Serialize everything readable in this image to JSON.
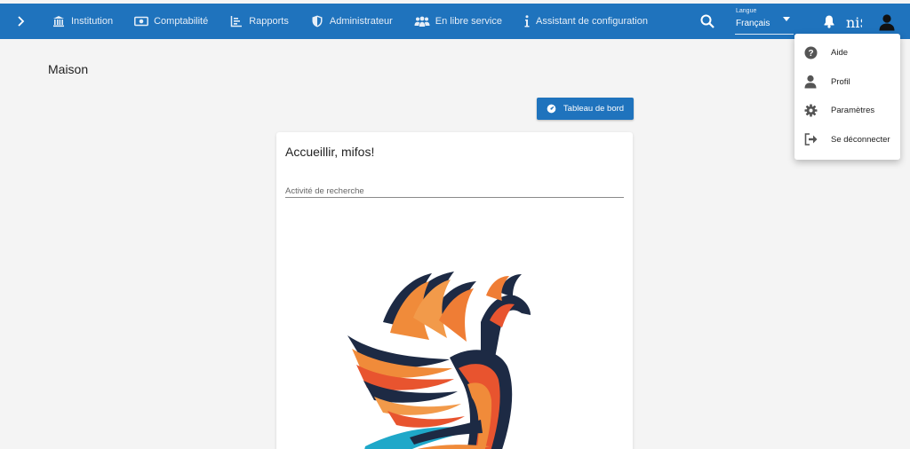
{
  "nav": {
    "items": [
      {
        "label": "Institution",
        "icon": "institution-icon"
      },
      {
        "label": "Comptabilité",
        "icon": "money-icon"
      },
      {
        "label": "Rapports",
        "icon": "chart-icon"
      },
      {
        "label": "Administrateur",
        "icon": "shield-icon"
      },
      {
        "label": "En libre service",
        "icon": "users-icon"
      },
      {
        "label": "Assistant de configuration",
        "icon": "info-icon"
      }
    ],
    "language_label": "Langue",
    "language_value": "Français",
    "brand_text": "ni$"
  },
  "page": {
    "title": "Maison",
    "dashboard_button": "Tableau de bord"
  },
  "card": {
    "welcome": "Accueillir, mifos!",
    "search_placeholder": "Activité de recherche"
  },
  "user_menu": [
    {
      "label": "Aide",
      "icon": "help-icon"
    },
    {
      "label": "Profil",
      "icon": "person-icon"
    },
    {
      "label": "Paramètres",
      "icon": "gear-icon"
    },
    {
      "label": "Se déconnecter",
      "icon": "logout-icon"
    }
  ],
  "colors": {
    "primary": "#1f73bd",
    "background": "#f4f4f4"
  }
}
